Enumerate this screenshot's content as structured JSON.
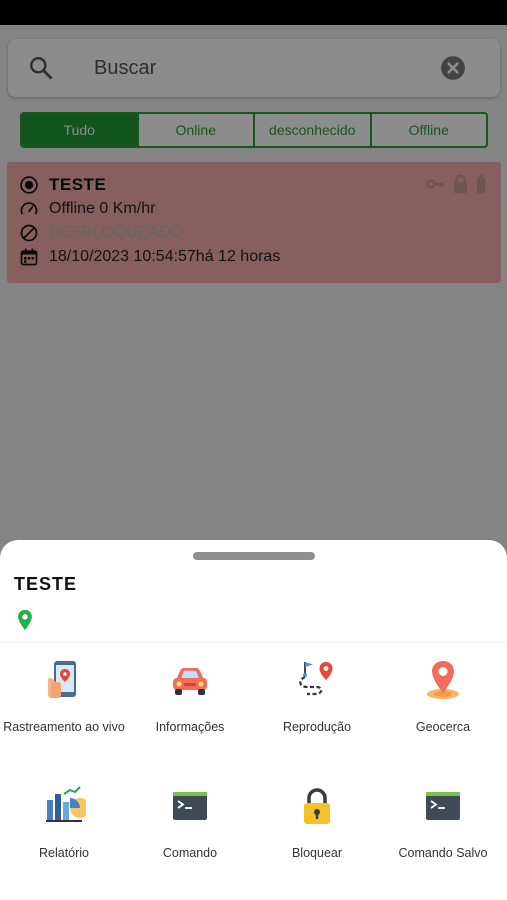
{
  "search": {
    "placeholder": "Buscar"
  },
  "filters": [
    {
      "label": "Tudo",
      "active": true
    },
    {
      "label": "Online",
      "active": false
    },
    {
      "label": "desconhecido",
      "active": false
    },
    {
      "label": "Offline",
      "active": false
    }
  ],
  "device": {
    "name": "TESTE",
    "speed": "Offline 0 Km/hr",
    "lock_status": "DESBLOQUEADO",
    "datetime": "18/10/2023 10:54:57há 12 horas",
    "status_icons": [
      "key-icon",
      "lock-icon",
      "battery-icon"
    ],
    "card_color": "#f3b0ac"
  },
  "sheet": {
    "title": "TESTE",
    "actions": [
      {
        "label": "Rastreamento ao vivo",
        "icon": "live-tracking-icon"
      },
      {
        "label": "Informações",
        "icon": "car-icon"
      },
      {
        "label": "Reprodução",
        "icon": "route-playback-icon"
      },
      {
        "label": "Geocerca",
        "icon": "geofence-icon"
      },
      {
        "label": "Relatório",
        "icon": "report-icon"
      },
      {
        "label": "Comando",
        "icon": "terminal-icon"
      },
      {
        "label": "Bloquear",
        "icon": "padlock-icon"
      },
      {
        "label": "Comando Salvo",
        "icon": "saved-command-icon"
      }
    ]
  },
  "colors": {
    "accent": "#1f9a35",
    "pin": "#21b04b"
  }
}
